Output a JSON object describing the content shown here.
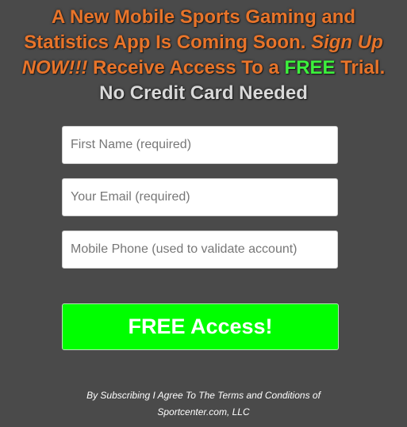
{
  "headline": {
    "line1": "A New Mobile Sports Gaming and",
    "line2_part1": "Statistics App Is Coming Soon. ",
    "line2_signup": "Sign Up",
    "line3_now": "NOW!!!",
    "line3_part2": " Receive Access To a ",
    "line3_free": "FREE",
    "line3_part3": " Trial.",
    "line4": "No Credit Card Needed"
  },
  "form": {
    "first_name_placeholder": "First Name (required)",
    "email_placeholder": "Your Email (required)",
    "phone_placeholder": "Mobile Phone (used to validate account)",
    "submit_label": "FREE Access!"
  },
  "terms": {
    "line1": "By Subscribing I Agree To The Terms and Conditions of",
    "line2": "Sportcenter.com, LLC"
  },
  "colors": {
    "background": "#4a4a4a",
    "headline": "#e8742a",
    "free_accent": "#3cf03c",
    "button": "#00ff00"
  }
}
